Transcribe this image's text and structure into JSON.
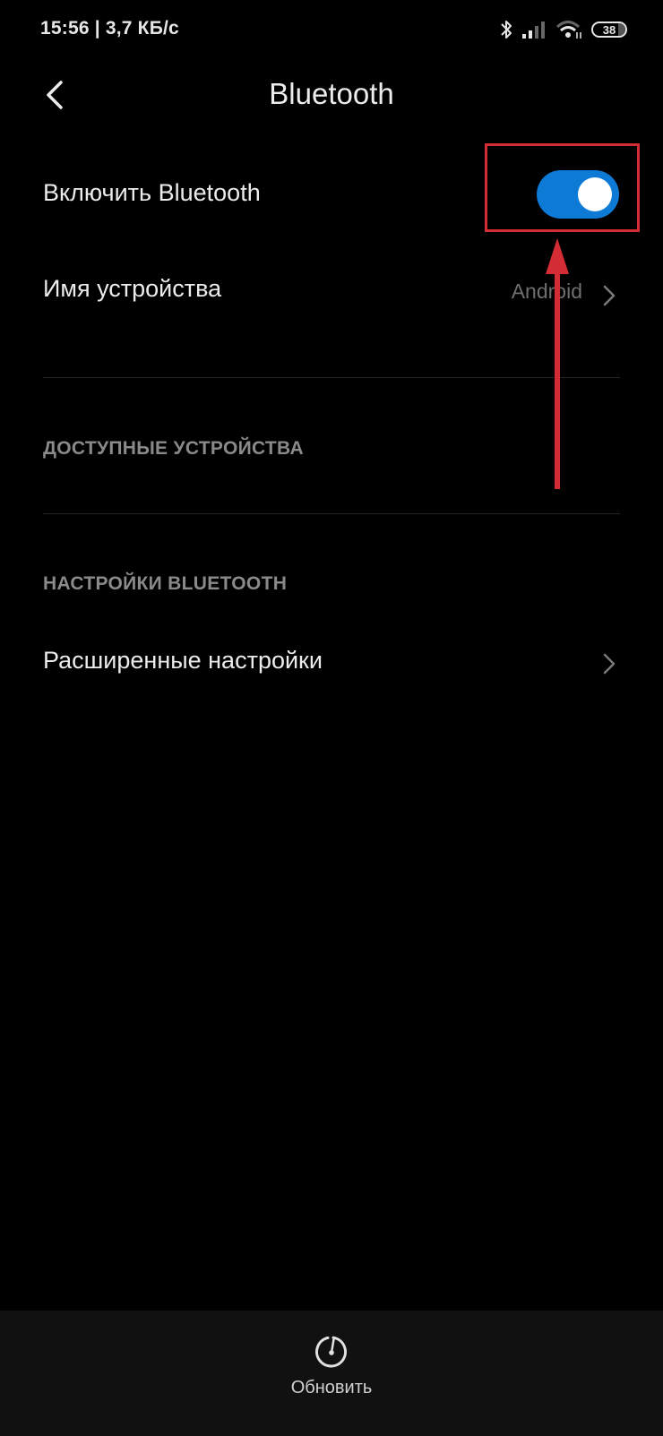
{
  "status_bar": {
    "time_speed": "15:56 | 3,7 КБ/с",
    "battery_level": "38",
    "icons": [
      "bluetooth-icon",
      "signal-icon",
      "wifi-icon",
      "battery-icon"
    ]
  },
  "header": {
    "title": "Bluetooth",
    "back_icon": "chevron-left-icon"
  },
  "settings": {
    "enable_bluetooth": {
      "label": "Включить Bluetooth",
      "enabled": true,
      "accent": "#0d7ad6"
    },
    "device_name": {
      "label": "Имя устройства",
      "value": "Android"
    },
    "available_devices_header": "ДОСТУПНЫЕ УСТРОЙСТВА",
    "bluetooth_settings_header": "НАСТРОЙКИ BLUETOOTH",
    "advanced_settings": {
      "label": "Расширенные настройки"
    }
  },
  "annotation": {
    "color": "#d42c34"
  },
  "bottom_bar": {
    "refresh_label": "Обновить",
    "refresh_icon": "refresh-timer-icon"
  }
}
